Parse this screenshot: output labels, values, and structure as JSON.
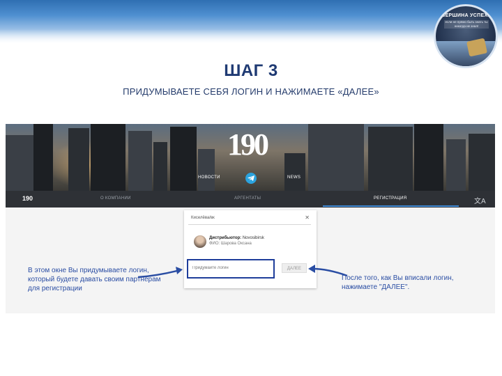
{
  "slide": {
    "title": "ШАГ 3",
    "subtitle": "ПРИДУМЫВАЕТЕ СЕБЯ ЛОГИН И НАЖИМАЕТЕ «ДАЛЕЕ»"
  },
  "badge": {
    "title": "ВЕРШИНА УСПЕХА",
    "text": "если не прямо быть знать ты никогда не знал!"
  },
  "site": {
    "logo": "190",
    "hero_links": [
      "НОВОСТИ",
      "NEWS"
    ],
    "nav": {
      "logo": "190",
      "items": [
        "О КОМПАНИИ",
        "АРГЕНТАТЫ",
        "РЕГИСТРАЦИЯ"
      ],
      "active_index": 2
    },
    "form": {
      "search_value": "Киселёва/вк",
      "distributor_label": "Дистрибьютор:",
      "distributor_value": "Novosibirsk",
      "fio_label": "ФИО:",
      "fio_value": "Шарова Оксана",
      "login_placeholder": "Придумайте логин",
      "next_label": "ДАЛЕЕ"
    }
  },
  "annotations": {
    "left": "В этом окне Вы придумываете логин, который будете давать своим партнерам для регистрации",
    "right": "После того, как Вы вписали логин, нажимаете \"ДАЛЕЕ\"."
  },
  "colors": {
    "title": "#1f3a73",
    "annotation": "#2a4da3",
    "highlight_border": "#1e3d9a",
    "navbar": "#2e3136",
    "nav_underline": "#3f8ad6"
  }
}
